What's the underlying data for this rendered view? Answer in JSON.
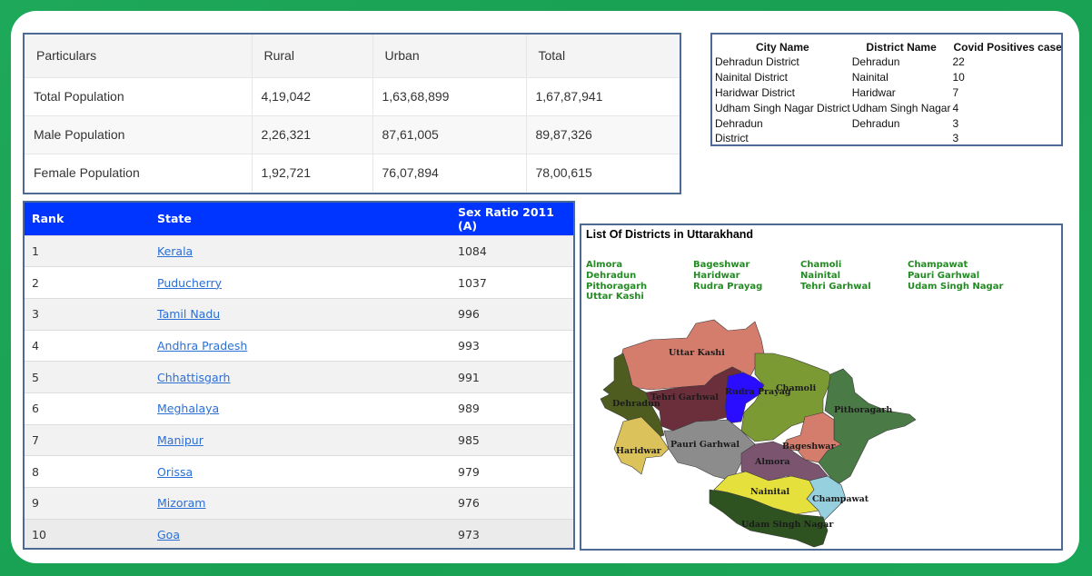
{
  "population_table": {
    "headers": [
      "Particulars",
      "Rural",
      "Urban",
      "Total"
    ],
    "rows": [
      [
        "Total Population",
        "4,19,042",
        "1,63,68,899",
        "1,67,87,941"
      ],
      [
        "Male Population",
        "2,26,321",
        "87,61,005",
        "89,87,326"
      ],
      [
        "Female Population",
        "1,92,721",
        "76,07,894",
        "78,00,615"
      ]
    ]
  },
  "covid_table": {
    "headers": [
      "City Name",
      "District Name",
      "Covid Positives cases"
    ],
    "rows": [
      [
        "Dehradun District",
        "Dehradun",
        "22"
      ],
      [
        "Nainital District",
        "Nainital",
        "10"
      ],
      [
        "Haridwar District",
        "Haridwar",
        "7"
      ],
      [
        "Udham Singh Nagar District",
        "Udham Singh Nagar",
        "4"
      ],
      [
        "Dehradun",
        "Dehradun",
        "3"
      ],
      [
        "District",
        "",
        "3"
      ]
    ]
  },
  "sex_ratio_table": {
    "header_bg": "#0034ff",
    "headers": [
      "Rank",
      "State",
      "Sex Ratio 2011 (A)"
    ],
    "rows": [
      [
        "1",
        "Kerala",
        "1084"
      ],
      [
        "2",
        "Puducherry",
        "1037"
      ],
      [
        "3",
        "Tamil Nadu",
        "996"
      ],
      [
        "4",
        "Andhra Pradesh",
        "993"
      ],
      [
        "5",
        "Chhattisgarh",
        "991"
      ],
      [
        "6",
        "Meghalaya",
        "989"
      ],
      [
        "7",
        "Manipur",
        "985"
      ],
      [
        "8",
        "Orissa",
        "979"
      ],
      [
        "9",
        "Mizoram",
        "976"
      ],
      [
        "10",
        "Goa",
        "973"
      ]
    ]
  },
  "districts_panel": {
    "title": "List Of Districts in Uttarakhand",
    "link_color": "#228b22",
    "districts": [
      "Almora",
      "Bageshwar",
      "Chamoli",
      "Champawat",
      "Dehradun",
      "Haridwar",
      "Nainital",
      "Pauri Garhwal",
      "Pithoragarh",
      "Rudra Prayag",
      "Tehri Garhwal",
      "Udam Singh Nagar",
      "Uttar Kashi"
    ],
    "map": {
      "regions": [
        {
          "name": "Uttar Kashi",
          "color": "#d47d6c"
        },
        {
          "name": "Dehradun",
          "color": "#4e5c1f"
        },
        {
          "name": "Tehri Garhwal",
          "color": "#6b2f3c"
        },
        {
          "name": "Rudra Prayag",
          "color": "#2a0cff"
        },
        {
          "name": "Chamoli",
          "color": "#7c9a33"
        },
        {
          "name": "Pithoragarh",
          "color": "#4a7a45"
        },
        {
          "name": "Haridwar",
          "color": "#dcc25a"
        },
        {
          "name": "Pauri Garhwal",
          "color": "#8c8c8c"
        },
        {
          "name": "Bageshwar",
          "color": "#d47d6c"
        },
        {
          "name": "Almora",
          "color": "#7b5470"
        },
        {
          "name": "Nainital",
          "color": "#e5e03c"
        },
        {
          "name": "Champawat",
          "color": "#96d0de"
        },
        {
          "name": "Udam Singh Nagar",
          "color": "#2e5220"
        }
      ]
    }
  }
}
